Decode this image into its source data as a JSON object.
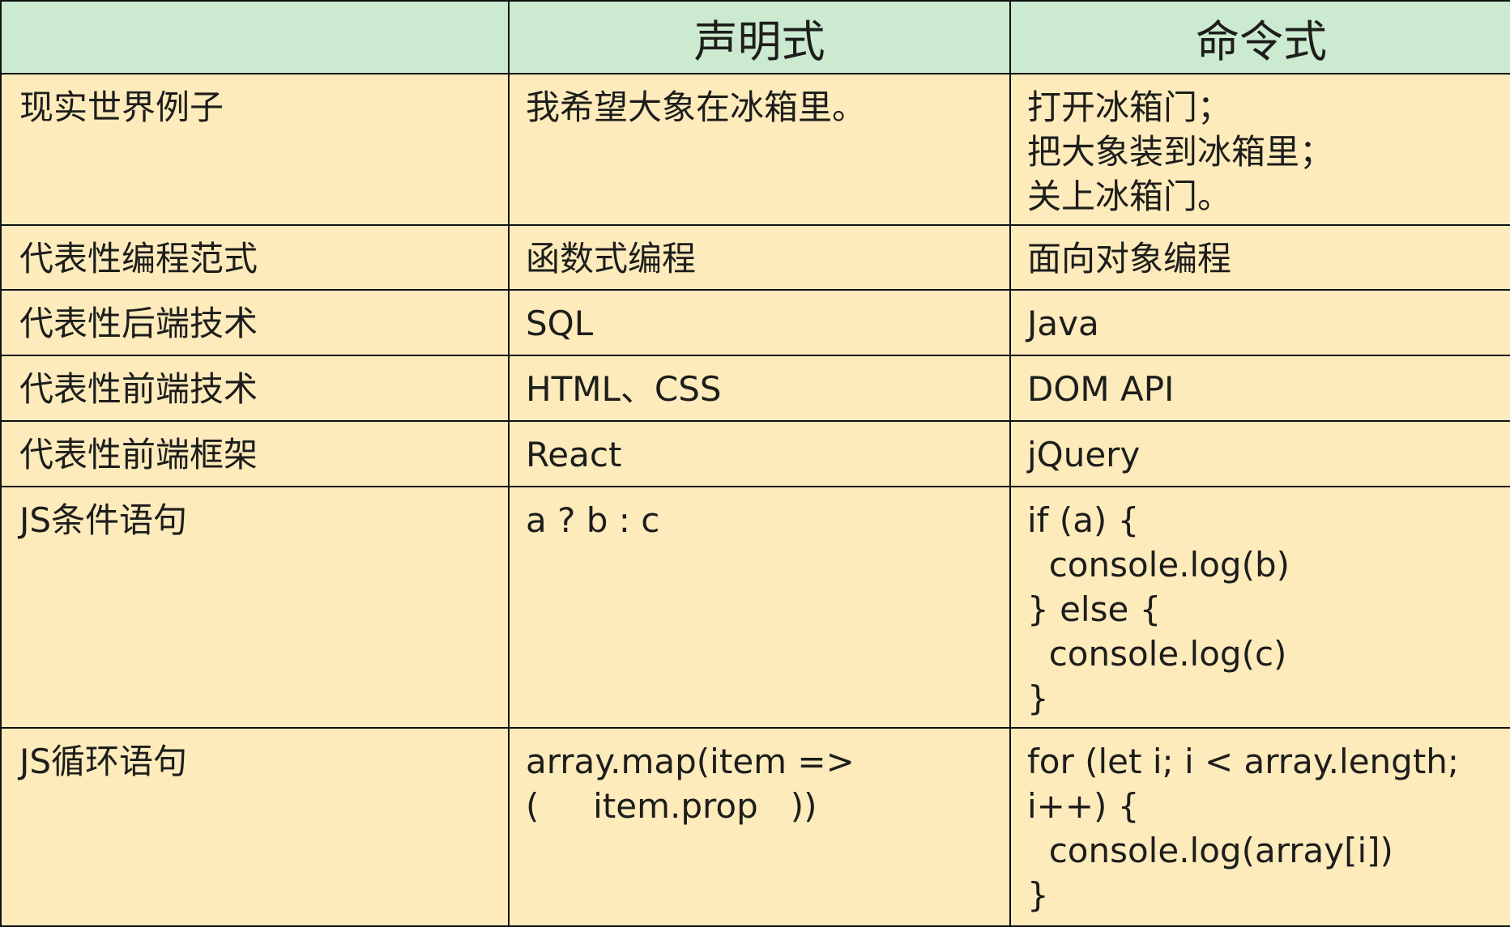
{
  "table": {
    "headers": [
      "",
      "声明式",
      "命令式"
    ],
    "rows": [
      {
        "label": "现实世界例子",
        "declarative": "我希望大象在冰箱里。",
        "imperative": "打开冰箱门；\n把大象装到冰箱里；\n关上冰箱门。"
      },
      {
        "label": "代表性编程范式",
        "declarative": "函数式编程",
        "imperative": "面向对象编程"
      },
      {
        "label": "代表性后端技术",
        "declarative": "SQL",
        "imperative": "Java"
      },
      {
        "label": "代表性前端技术",
        "declarative": "HTML、CSS",
        "imperative": "DOM API"
      },
      {
        "label": "代表性前端框架",
        "declarative": "React",
        "imperative": "jQuery"
      },
      {
        "label": "JS条件语句",
        "declarative": "a ? b : c",
        "imperative": "if (a) {\n  console.log(b)\n} else {\n  console.log(c)\n}"
      },
      {
        "label": "JS循环语句",
        "declarative": "array.map(item =>\n(     item.prop   ))",
        "imperative": "for (let i; i < array.length;\ni++) {\n  console.log(array[i])\n}"
      }
    ]
  }
}
